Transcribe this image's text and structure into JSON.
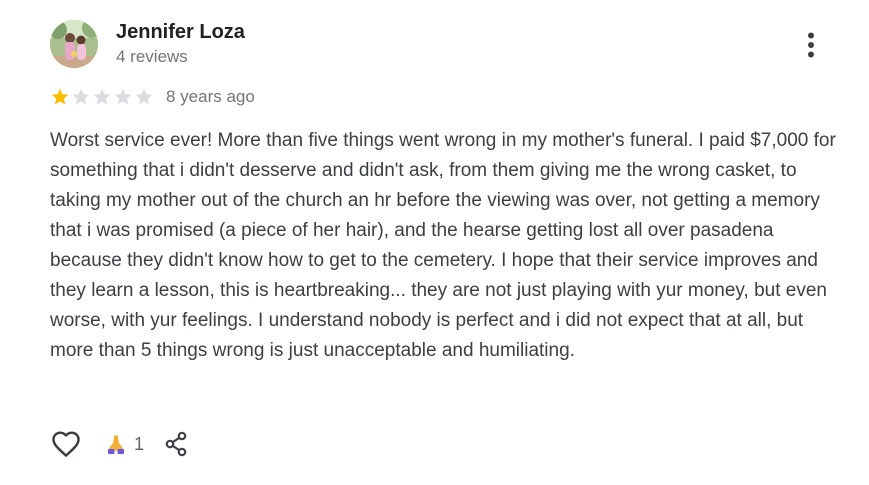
{
  "review": {
    "author_name": "Jennifer Loza",
    "review_count": "4 reviews",
    "rating": 1,
    "max_rating": 5,
    "date": "8 years ago",
    "text": "Worst service ever! More than five things went wrong in my mother's funeral. I paid $7,000 for something that i didn't desserve and didn't ask, from them giving me the wrong casket, to taking my mother out of the church an hr before the viewing was over, not getting a memory that i was promised (a piece of her hair), and the hearse getting lost all over pasadena because they didn't know how to get to the cemetery. I hope that their service improves and they learn a lesson, this is heartbreaking... they are not just playing with yur money, but even worse, with yur feelings. I understand nobody is perfect and i did not expect that at all, but more than 5 things wrong is just unacceptable and humiliating."
  },
  "actions": {
    "reaction_count": "1",
    "icons": [
      "heart-outline-icon",
      "folded-hands-icon",
      "share-icon",
      "more-vert-icon"
    ]
  },
  "colors": {
    "star_filled": "#fbbc04",
    "star_empty": "#dadce0",
    "text_primary": "#202124",
    "text_secondary": "#70757a",
    "icon": "#3c4043"
  }
}
